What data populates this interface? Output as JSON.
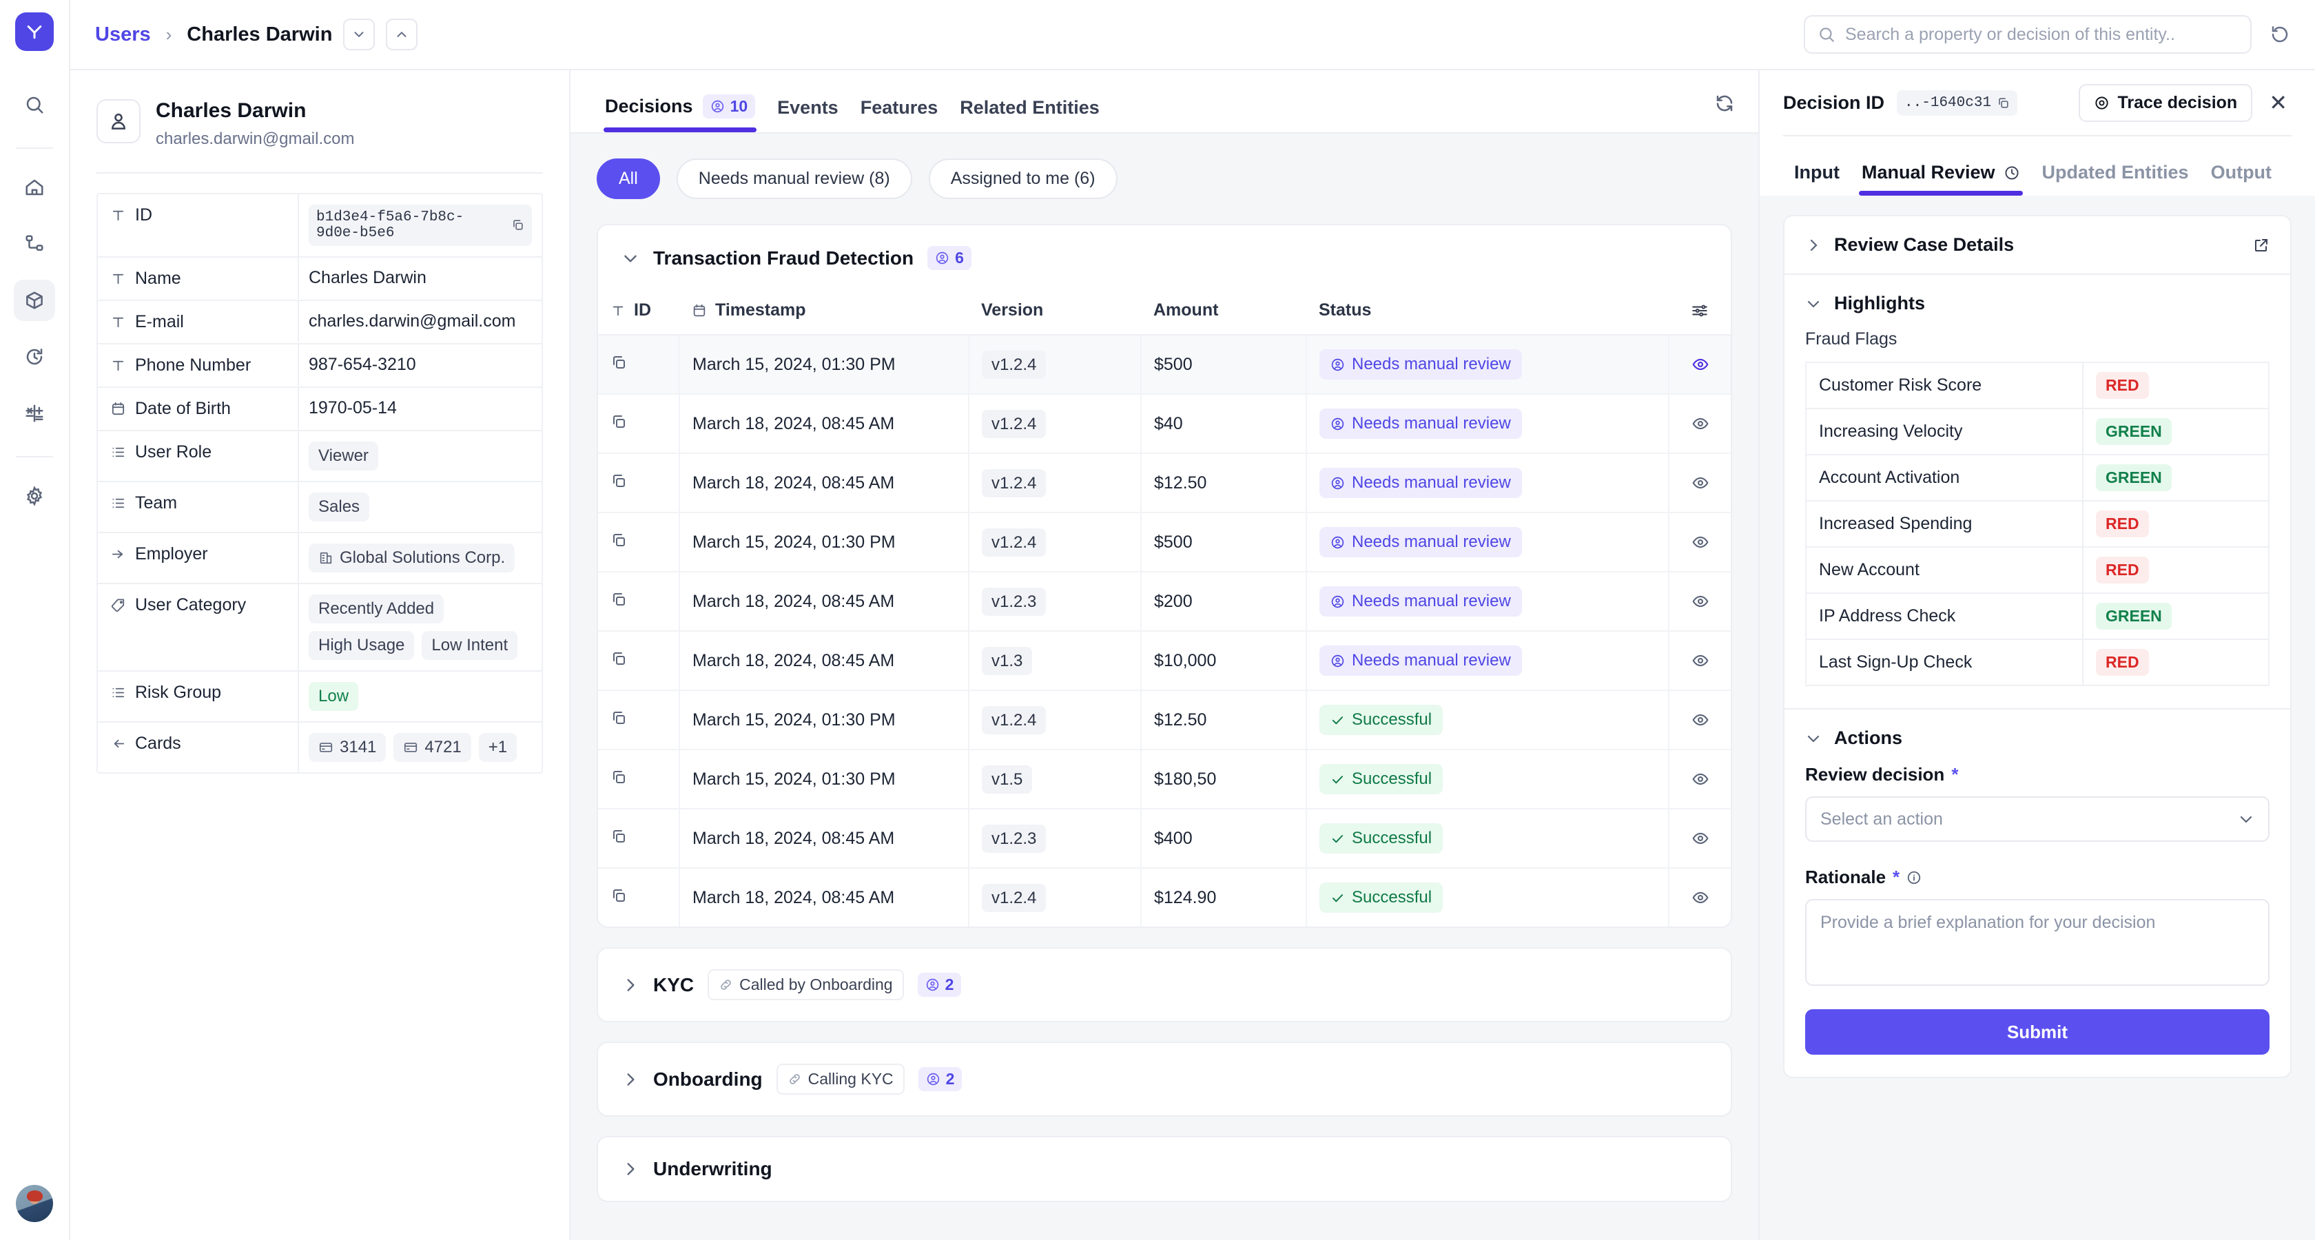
{
  "app": {
    "logo_glyph": "Y",
    "accent": "#4f46e5",
    "accent_strong": "#4f2fe0",
    "red": "#dc2626",
    "green": "#12804b"
  },
  "topbar": {
    "breadcrumb_root": "Users",
    "breadcrumb_sep": "›",
    "breadcrumb_current": "Charles Darwin",
    "prev_glyph": "⌄",
    "next_glyph": "⌃",
    "search_placeholder": "Search a property or decision of this entity..",
    "search_value": ""
  },
  "rail": {
    "items": [
      {
        "name": "search-icon"
      },
      {
        "name": "home-icon"
      },
      {
        "name": "workflow-icon"
      },
      {
        "name": "entities-icon",
        "active": true
      },
      {
        "name": "history-icon"
      },
      {
        "name": "formula-icon"
      },
      {
        "name": "settings-icon"
      }
    ]
  },
  "entity": {
    "name": "Charles Darwin",
    "email": "charles.darwin@gmail.com",
    "properties": [
      {
        "icon": "text-icon",
        "key": "ID",
        "type": "mono",
        "value": "b1d3e4-f5a6-7b8c-9d0e-b5e6"
      },
      {
        "icon": "text-icon",
        "key": "Name",
        "type": "plain",
        "value": "Charles Darwin"
      },
      {
        "icon": "text-icon",
        "key": "E-mail",
        "type": "plain",
        "value": "charles.darwin@gmail.com"
      },
      {
        "icon": "text-icon",
        "key": "Phone Number",
        "type": "plain",
        "value": "987-654-3210"
      },
      {
        "icon": "calendar-icon",
        "key": "Date of Birth",
        "type": "plain",
        "value": "1970-05-14"
      },
      {
        "icon": "list-icon",
        "key": "User Role",
        "type": "chips",
        "chips": [
          "Viewer"
        ]
      },
      {
        "icon": "list-icon",
        "key": "Team",
        "type": "chips",
        "chips": [
          "Sales"
        ]
      },
      {
        "icon": "arrow-icon",
        "key": "Employer",
        "type": "chips-icon",
        "chips": [
          "Global Solutions Corp."
        ]
      },
      {
        "icon": "tag-icon",
        "key": "User Category",
        "type": "chips",
        "chips": [
          "Recently Added",
          "High Usage",
          "Low Intent"
        ]
      },
      {
        "icon": "list-icon",
        "key": "Risk Group",
        "type": "chip-green",
        "chips": [
          "Low"
        ]
      },
      {
        "icon": "cards-icon",
        "key": "Cards",
        "type": "cards",
        "chips": [
          "3141",
          "4721"
        ],
        "more": "+1"
      }
    ]
  },
  "center": {
    "tabs": [
      {
        "label": "Decisions",
        "count": "10",
        "active": true
      },
      {
        "label": "Events",
        "active": false
      },
      {
        "label": "Features",
        "active": false
      },
      {
        "label": "Related Entities",
        "active": false
      }
    ],
    "filters": [
      {
        "label": "All",
        "active": true
      },
      {
        "label": "Needs manual review (8)",
        "active": false
      },
      {
        "label": "Assigned to me (6)",
        "active": false
      }
    ],
    "sections": [
      {
        "title": "Transaction Fraud Detection",
        "count": "6",
        "expanded": true,
        "link": null,
        "columns": [
          "ID",
          "Timestamp",
          "Version",
          "Amount",
          "Status"
        ],
        "rows": [
          {
            "timestamp": "March 15, 2024, 01:30 PM",
            "version": "v1.2.4",
            "amount": "$500",
            "status": "Needs manual review",
            "status_kind": "review",
            "selected": true
          },
          {
            "timestamp": "March 18, 2024, 08:45 AM",
            "version": "v1.2.4",
            "amount": "$40",
            "status": "Needs manual review",
            "status_kind": "review",
            "selected": false
          },
          {
            "timestamp": "March 18, 2024, 08:45 AM",
            "version": "v1.2.4",
            "amount": "$12.50",
            "status": "Needs manual review",
            "status_kind": "review",
            "selected": false
          },
          {
            "timestamp": "March 15, 2024, 01:30 PM",
            "version": "v1.2.4",
            "amount": "$500",
            "status": "Needs manual review",
            "status_kind": "review",
            "selected": false
          },
          {
            "timestamp": "March 18, 2024, 08:45 AM",
            "version": "v1.2.3",
            "amount": "$200",
            "status": "Needs manual review",
            "status_kind": "review",
            "selected": false
          },
          {
            "timestamp": "March 18, 2024, 08:45 AM",
            "version": "v1.3",
            "amount": "$10,000",
            "status": "Needs manual review",
            "status_kind": "review",
            "selected": false
          },
          {
            "timestamp": "March 15, 2024, 01:30 PM",
            "version": "v1.2.4",
            "amount": "$12.50",
            "status": "Successful",
            "status_kind": "ok",
            "selected": false
          },
          {
            "timestamp": "March 15, 2024, 01:30 PM",
            "version": "v1.5",
            "amount": "$180,50",
            "status": "Successful",
            "status_kind": "ok",
            "selected": false
          },
          {
            "timestamp": "March 18, 2024, 08:45 AM",
            "version": "v1.2.3",
            "amount": "$400",
            "status": "Successful",
            "status_kind": "ok",
            "selected": false
          },
          {
            "timestamp": "March 18, 2024, 08:45 AM",
            "version": "v1.2.4",
            "amount": "$124.90",
            "status": "Successful",
            "status_kind": "ok",
            "selected": false
          }
        ]
      },
      {
        "title": "KYC",
        "count": "2",
        "expanded": false,
        "link": "Called by Onboarding"
      },
      {
        "title": "Onboarding",
        "count": "2",
        "expanded": false,
        "link": "Calling KYC"
      },
      {
        "title": "Underwriting",
        "count": null,
        "expanded": false,
        "link": null
      }
    ]
  },
  "right": {
    "decision_id_label": "Decision ID",
    "decision_id_value": "..-1640c31",
    "trace_button": "Trace decision",
    "close_glyph": "✕",
    "tabs": [
      {
        "label": "Input",
        "active": false,
        "muted": false,
        "clock": false
      },
      {
        "label": "Manual Review",
        "active": true,
        "muted": false,
        "clock": true
      },
      {
        "label": "Updated Entities",
        "active": false,
        "muted": true,
        "clock": false
      },
      {
        "label": "Output",
        "active": false,
        "muted": true,
        "clock": false
      }
    ],
    "review_case_details": "Review Case Details",
    "highlights_title": "Highlights",
    "fraud_flags_label": "Fraud Flags",
    "fraud_flags": [
      {
        "name": "Customer Risk Score",
        "value": "RED",
        "kind": "red"
      },
      {
        "name": "Increasing Velocity",
        "value": "GREEN",
        "kind": "green"
      },
      {
        "name": "Account Activation",
        "value": "GREEN",
        "kind": "green"
      },
      {
        "name": "Increased Spending",
        "value": "RED",
        "kind": "red"
      },
      {
        "name": "New Account",
        "value": "RED",
        "kind": "red"
      },
      {
        "name": "IP Address Check",
        "value": "GREEN",
        "kind": "green"
      },
      {
        "name": "Last Sign-Up Check",
        "value": "RED",
        "kind": "red"
      }
    ],
    "actions_title": "Actions",
    "review_decision_label": "Review decision",
    "review_decision_value": "",
    "review_decision_placeholder": "Select an action",
    "rationale_label": "Rationale",
    "rationale_value": "",
    "rationale_placeholder": "Provide a brief explanation for your decision",
    "submit_label": "Submit"
  }
}
